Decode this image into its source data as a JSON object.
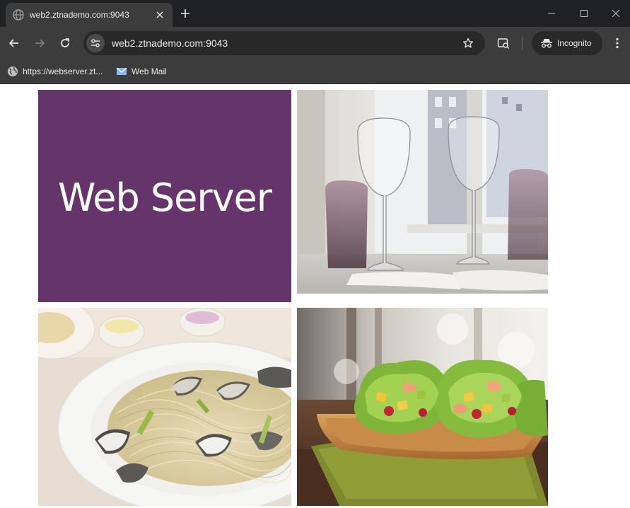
{
  "browser": {
    "tab": {
      "title": "web2.ztnademo.com:9043",
      "favicon": "globe-icon"
    },
    "address_bar": {
      "url": "web2.ztnademo.com:9043"
    },
    "profile": {
      "label": "Incognito"
    },
    "bookmarks": [
      {
        "label": "https://webserver.zt...",
        "icon": "globe-icon"
      },
      {
        "label": "Web Mail",
        "icon": "mail-icon"
      }
    ]
  },
  "page": {
    "heading": "Web Server",
    "images": [
      {
        "name": "wine-glasses-image",
        "description": "wine glasses on a table"
      },
      {
        "name": "pasta-clams-image",
        "description": "spaghetti with clams"
      },
      {
        "name": "salad-wraps-image",
        "description": "lettuce wraps on a wooden tray"
      }
    ]
  },
  "colors": {
    "hero_background": "#65346b",
    "chrome_dark": "#202124",
    "chrome_toolbar": "#3c3c3c"
  }
}
